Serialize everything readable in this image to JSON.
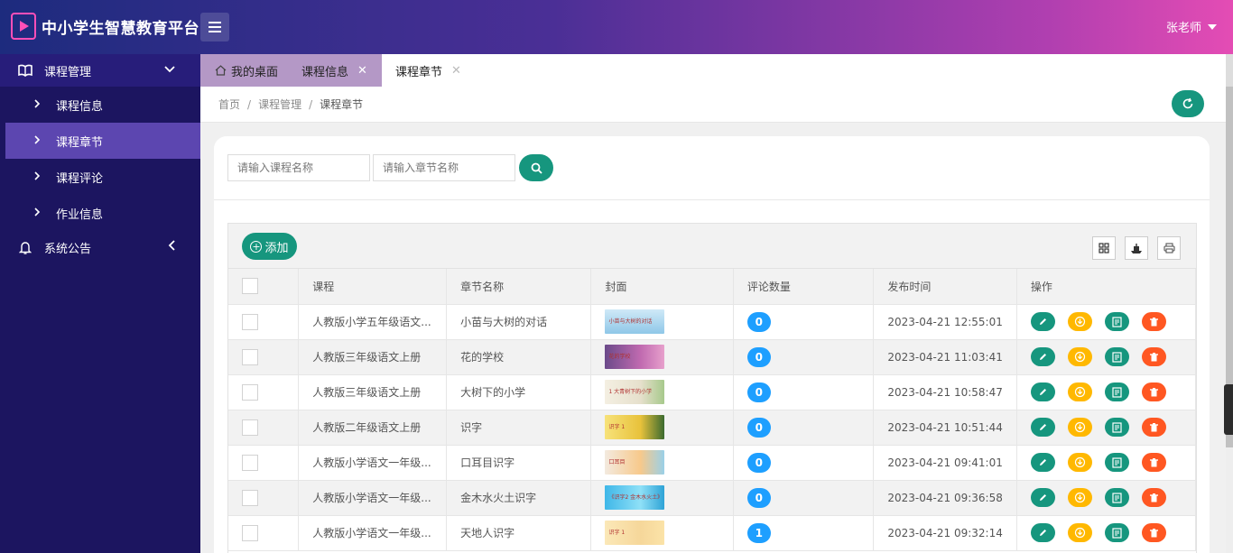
{
  "app": {
    "title": "中小学生智慧教育平台",
    "user": "张老师"
  },
  "sidebar": {
    "groups": [
      {
        "label": "课程管理",
        "items": [
          {
            "label": "课程信息"
          },
          {
            "label": "课程章节"
          },
          {
            "label": "课程评论"
          },
          {
            "label": "作业信息"
          }
        ]
      },
      {
        "label": "系统公告"
      }
    ]
  },
  "tabs": [
    {
      "label": "我的桌面"
    },
    {
      "label": "课程信息"
    },
    {
      "label": "课程章节"
    }
  ],
  "breadcrumb": {
    "home": "首页",
    "section": "课程管理",
    "current": "课程章节"
  },
  "search": {
    "course_placeholder": "请输入课程名称",
    "chapter_placeholder": "请输入章节名称"
  },
  "toolbar": {
    "add_label": "添加"
  },
  "table": {
    "columns": [
      "课程",
      "章节名称",
      "封面",
      "评论数量",
      "发布时间",
      "操作"
    ],
    "rows": [
      {
        "course": "人教版小学五年级语文...",
        "chapter": "小苗与大树的对话",
        "cover_text": "小苗与大树的对话",
        "comments": "0",
        "published": "2023-04-21 12:55:01"
      },
      {
        "course": "人教版三年级语文上册",
        "chapter": "花的学校",
        "cover_text": "花的学校",
        "comments": "0",
        "published": "2023-04-21 11:03:41"
      },
      {
        "course": "人教版三年级语文上册",
        "chapter": "大树下的小学",
        "cover_text": "1 大青树下的小学",
        "comments": "0",
        "published": "2023-04-21 10:58:47"
      },
      {
        "course": "人教版二年级语文上册",
        "chapter": "识字",
        "cover_text": "识字 1",
        "comments": "0",
        "published": "2023-04-21 10:51:44"
      },
      {
        "course": "人教版小学语文一年级...",
        "chapter": "口耳目识字",
        "cover_text": "口耳目",
        "comments": "0",
        "published": "2023-04-21 09:41:01"
      },
      {
        "course": "人教版小学语文一年级...",
        "chapter": "金木水火土识字",
        "cover_text": "《识字2 金木水火土》",
        "comments": "0",
        "published": "2023-04-21 09:36:58"
      },
      {
        "course": "人教版小学语文一年级...",
        "chapter": "天地人识字",
        "cover_text": "识字 1",
        "comments": "1",
        "published": "2023-04-21 09:32:14"
      }
    ]
  },
  "colors": {
    "primary": "#16967e",
    "warning": "#ffb800",
    "danger": "#ff5722",
    "info": "#1e9fff",
    "sidebar": "#1c1560",
    "sidebar_active": "#5c46b0"
  },
  "icons": {
    "logo": "play-icon",
    "menu": "hamburger-icon",
    "refresh": "refresh-icon",
    "search": "search-icon",
    "columns": "columns-icon",
    "export": "export-icon",
    "print": "print-icon"
  }
}
